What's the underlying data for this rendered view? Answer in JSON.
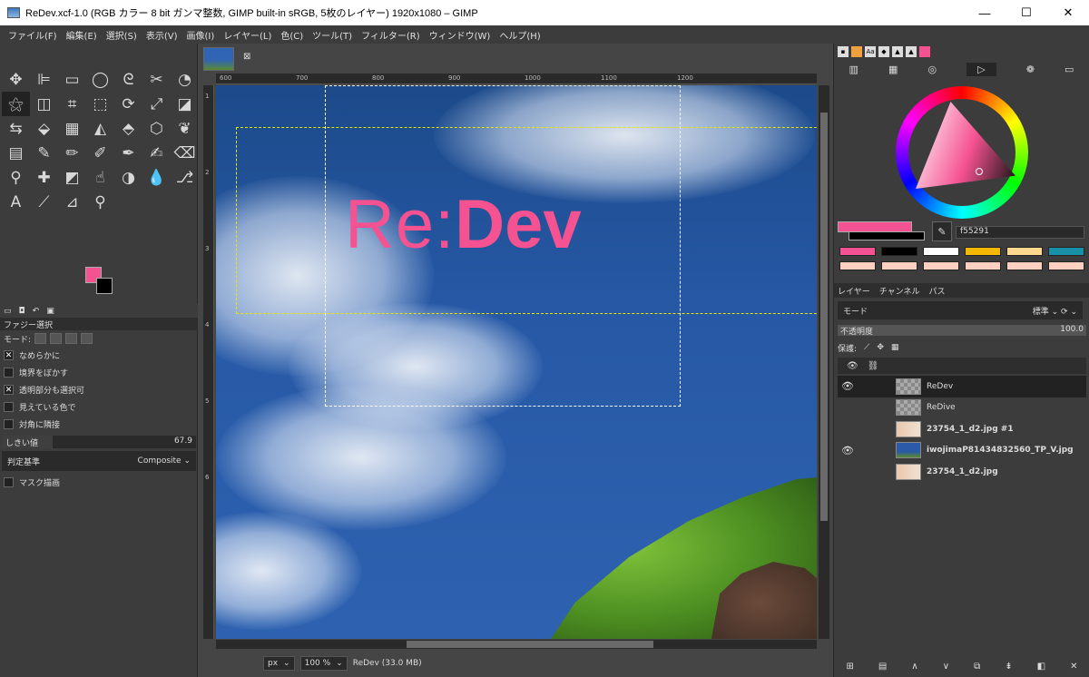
{
  "window": {
    "title": "ReDev.xcf-1.0 (RGB カラー 8 bit ガンマ整数, GIMP built-in sRGB, 5枚のレイヤー) 1920x1080 – GIMP",
    "minimize": "—",
    "maximize": "☐",
    "close": "✕"
  },
  "menu": [
    "ファイル(F)",
    "編集(E)",
    "選択(S)",
    "表示(V)",
    "画像(I)",
    "レイヤー(L)",
    "色(C)",
    "ツール(T)",
    "フィルター(R)",
    "ウィンドウ(W)",
    "ヘルプ(H)"
  ],
  "tools": [
    {
      "name": "move-tool-icon",
      "glyph": "✥"
    },
    {
      "name": "align-tool-icon",
      "glyph": "⊫"
    },
    {
      "name": "rect-select-icon",
      "glyph": "▭"
    },
    {
      "name": "ellipse-select-icon",
      "glyph": "◯"
    },
    {
      "name": "free-select-icon",
      "glyph": "ᘓ"
    },
    {
      "name": "scissors-select-icon",
      "glyph": "✂"
    },
    {
      "name": "foreground-select-icon",
      "glyph": "◔"
    },
    {
      "name": "fuzzy-select-icon",
      "glyph": "⚝"
    },
    {
      "name": "by-color-select-icon",
      "glyph": "◫"
    },
    {
      "name": "crop-tool-icon",
      "glyph": "⌗"
    },
    {
      "name": "unified-transform-icon",
      "glyph": "⬚"
    },
    {
      "name": "rotate-tool-icon",
      "glyph": "⟳"
    },
    {
      "name": "scale-tool-icon",
      "glyph": "⤢"
    },
    {
      "name": "shear-tool-icon",
      "glyph": "◪"
    },
    {
      "name": "flip-tool-icon",
      "glyph": "⇆"
    },
    {
      "name": "perspective-tool-icon",
      "glyph": "⬙"
    },
    {
      "name": "3d-transform-icon",
      "glyph": "▦"
    },
    {
      "name": "warp-transform-icon",
      "glyph": "◭"
    },
    {
      "name": "handle-transform-icon",
      "glyph": "⬘"
    },
    {
      "name": "cage-transform-icon",
      "glyph": "⬡"
    },
    {
      "name": "warp-icon",
      "glyph": "❦"
    },
    {
      "name": "blend-tool-icon",
      "glyph": "▤"
    },
    {
      "name": "paintbrush-icon",
      "glyph": "✎"
    },
    {
      "name": "pencil-icon",
      "glyph": "✏"
    },
    {
      "name": "airbrush-icon",
      "glyph": "✐"
    },
    {
      "name": "ink-icon",
      "glyph": "✒"
    },
    {
      "name": "mypaint-brush-icon",
      "glyph": "✍"
    },
    {
      "name": "eraser-icon",
      "glyph": "⌫"
    },
    {
      "name": "clone-tool-icon",
      "glyph": "⚲"
    },
    {
      "name": "heal-tool-icon",
      "glyph": "✚"
    },
    {
      "name": "perspective-clone-icon",
      "glyph": "◩"
    },
    {
      "name": "smudge-tool-icon",
      "glyph": "☝"
    },
    {
      "name": "dodge-burn-icon",
      "glyph": "◑"
    },
    {
      "name": "blur-tool-icon",
      "glyph": "💧"
    },
    {
      "name": "paths-tool-icon",
      "glyph": "⎇"
    },
    {
      "name": "text-tool-icon",
      "glyph": "A"
    },
    {
      "name": "color-picker-icon",
      "glyph": "⟋"
    },
    {
      "name": "measure-tool-icon",
      "glyph": "⊿"
    },
    {
      "name": "zoom-tool-icon",
      "glyph": "⚲"
    },
    {
      "name": "",
      "glyph": ""
    },
    {
      "name": "",
      "glyph": ""
    },
    {
      "name": "",
      "glyph": ""
    }
  ],
  "colors": {
    "fg": "#f55291",
    "bg": "#000000"
  },
  "tool_options": {
    "title": "ファジー選択",
    "mode_label": "モード:",
    "checks": [
      {
        "label": "なめらかに",
        "checked": true
      },
      {
        "label": "境界をぼかす",
        "checked": false
      },
      {
        "label": "透明部分も選択可",
        "checked": true
      },
      {
        "label": "見えている色で",
        "checked": false
      },
      {
        "label": "対角に隣接",
        "checked": false
      }
    ],
    "threshold_label": "しきい値",
    "threshold_value": "67.9",
    "criterion_label": "判定基準",
    "criterion_value": "Composite",
    "draw_mask": "マスク描画"
  },
  "canvas": {
    "ruler_h": [
      "600",
      "700",
      "800",
      "900",
      "1000",
      "1100",
      "1200"
    ],
    "ruler_v": [
      "1",
      "2",
      "3",
      "4",
      "5",
      "6"
    ],
    "logo_re": "Re:",
    "logo_dev": "Dev"
  },
  "status": {
    "unit": "px",
    "zoom": "100 %",
    "info": "ReDev (33.0 MB)"
  },
  "dock": {
    "hex": "f55291",
    "swatches": [
      "#f55291",
      "#000000",
      "#ffffff",
      "#f5b800",
      "#ffd890",
      "#1a8fa8",
      "#ffd0c0",
      "#ffd0c0",
      "#ffd0c0",
      "#ffd0c0",
      "#ffd0c0",
      "#ffd0c0"
    ],
    "tabs": [
      "レイヤー",
      "チャンネル",
      "パス"
    ],
    "mode_label": "モード",
    "mode_value": "標準",
    "opacity_label": "不透明度",
    "opacity_value": "100.0",
    "lock_label": "保護:"
  },
  "layers": [
    {
      "name": "ReDev",
      "visible": true,
      "bold": false,
      "current": true,
      "thumb": "checker"
    },
    {
      "name": "ReDive",
      "visible": false,
      "bold": false,
      "current": false,
      "thumb": "checker"
    },
    {
      "name": "23754_1_d2.jpg #1",
      "visible": false,
      "bold": true,
      "current": false,
      "thumb": "photo"
    },
    {
      "name": "iwojimaP81434832560_TP_V.jpg",
      "visible": true,
      "bold": true,
      "current": false,
      "thumb": "sky"
    },
    {
      "name": "23754_1_d2.jpg",
      "visible": false,
      "bold": true,
      "current": false,
      "thumb": "photo"
    }
  ]
}
